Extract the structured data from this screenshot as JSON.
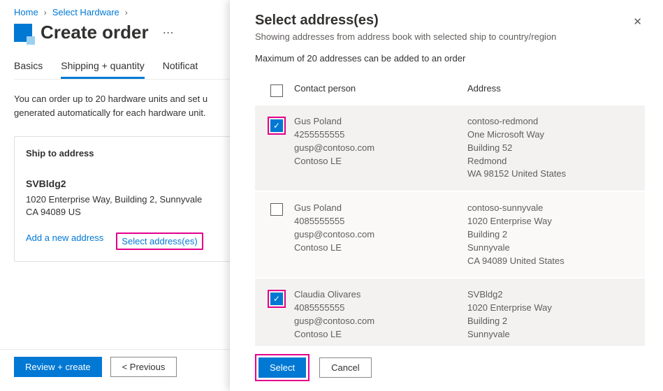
{
  "breadcrumb": {
    "home": "Home",
    "select_hw": "Select Hardware"
  },
  "page": {
    "title": "Create order",
    "tabs": {
      "basics": "Basics",
      "shipping": "Shipping + quantity",
      "notifications": "Notificat"
    },
    "desc_l1": "You can order up to 20 hardware units and set u",
    "desc_l2": "generated automatically for each hardware unit.",
    "ship_header": "Ship to address",
    "addr_name": "SVBldg2",
    "addr_line1": "1020 Enterprise Way, Building 2, Sunnyvale",
    "addr_line2": "CA 94089 US",
    "link_add": "Add a new address",
    "link_select": "Select address(es)",
    "review_btn": "Review + create",
    "prev_btn": "< Previous"
  },
  "panel": {
    "title": "Select address(es)",
    "subtitle": "Showing addresses from address book with selected ship to country/region",
    "note": "Maximum of 20 addresses can be added to an order",
    "col_contact": "Contact person",
    "col_address": "Address",
    "select_btn": "Select",
    "cancel_btn": "Cancel",
    "rows": [
      {
        "checked": true,
        "highlight": true,
        "shaded": true,
        "contact": [
          "Gus Poland",
          "4255555555",
          "gusp@contoso.com",
          "Contoso LE"
        ],
        "address": [
          "contoso-redmond",
          "One Microsoft Way",
          "Building 52",
          "Redmond",
          "WA 98152 United States"
        ]
      },
      {
        "checked": false,
        "highlight": false,
        "shaded": false,
        "contact": [
          "Gus Poland",
          "4085555555",
          "gusp@contoso.com",
          "Contoso LE"
        ],
        "address": [
          "contoso-sunnyvale",
          "1020 Enterprise Way",
          "Building 2",
          "Sunnyvale",
          "CA 94089 United States"
        ]
      },
      {
        "checked": true,
        "highlight": true,
        "shaded": true,
        "contact": [
          "Claudia Olivares",
          "4085555555",
          "gusp@contoso.com",
          "Contoso LE"
        ],
        "address": [
          "SVBldg2",
          "1020 Enterprise Way",
          "Building 2",
          "Sunnyvale"
        ]
      }
    ]
  }
}
